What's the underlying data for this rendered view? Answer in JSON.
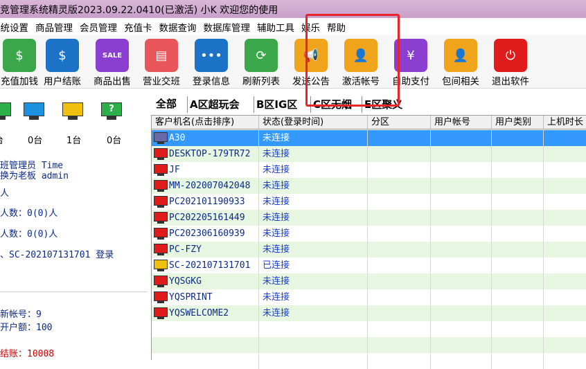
{
  "window": {
    "title": "竞管理系统精灵版2023.09.22.0410(已激活)  小K 欢迎您的使用"
  },
  "menu": [
    "系统设置",
    "商品管理",
    "会员管理",
    "充值卡",
    "数据查询",
    "数据库管理",
    "辅助工具",
    "娱乐",
    "帮助"
  ],
  "toolbar": [
    {
      "label": "充值加钱",
      "icon": "money-bag-icon",
      "color": "#3aa84a",
      "glyph": "$"
    },
    {
      "label": "用户结账",
      "icon": "checkout-icon",
      "color": "#1b72c7",
      "glyph": "$"
    },
    {
      "label": "商品出售",
      "icon": "sale-tag-icon",
      "color": "#8a3fd1",
      "glyph": "SALE"
    },
    {
      "label": "营业交班",
      "icon": "shift-icon",
      "color": "#e8565a",
      "glyph": "▤"
    },
    {
      "label": "登录信息",
      "icon": "chat-icon",
      "color": "#1b72c7",
      "glyph": "•••"
    },
    {
      "label": "刷新列表",
      "icon": "refresh-icon",
      "color": "#3aa84a",
      "glyph": "⟳"
    },
    {
      "label": "发送公告",
      "icon": "megaphone-icon",
      "color": "#f0a41b",
      "glyph": "📢"
    },
    {
      "label": "激活帐号",
      "icon": "user-icon",
      "color": "#f0a41b",
      "glyph": "👤"
    },
    {
      "label": "自助支付",
      "icon": "pay-icon",
      "color": "#8a3fd1",
      "glyph": "¥"
    },
    {
      "label": "包间相关",
      "icon": "room-user-icon",
      "color": "#f0a41b",
      "glyph": "👤"
    },
    {
      "label": "退出软件",
      "icon": "power-icon",
      "color": "#e01b1b",
      "glyph": "⏻"
    }
  ],
  "left": {
    "monitors": [
      {
        "color": "#2db04a",
        "count": "台",
        "label": ""
      },
      {
        "color": "#1e90e0",
        "count": "0台",
        "label": ""
      },
      {
        "color": "#f0c010",
        "count": "1台",
        "label": ""
      },
      {
        "color": "#2db04a",
        "count": "0台",
        "label": "?"
      }
    ],
    "lines": [
      "班管理员 Time",
      "换为老板 admin",
      "人",
      "人数：0(0)人",
      "人数：0(0)人",
      "、SC-202107131701 登录"
    ],
    "lower": [
      "新帐号：9",
      "开户额：100"
    ],
    "checkout": "结账：10008"
  },
  "tabs": [
    "全部",
    "A区超玩会",
    "B区IG区",
    "C区无烟",
    "E区聚义"
  ],
  "columns": [
    "客户机名(点击排序)",
    "状态(登录时间)",
    "分区",
    "用户帐号",
    "用户类别",
    "上机时长"
  ],
  "rows": [
    {
      "name": "A30",
      "status": "未连接",
      "icon": "#6a6aaa",
      "selected": true
    },
    {
      "name": "DESKTOP-179TR72",
      "status": "未连接",
      "icon": "#e01b1b"
    },
    {
      "name": "JF",
      "status": "未连接",
      "icon": "#e01b1b"
    },
    {
      "name": "MM-202007042048",
      "status": "未连接",
      "icon": "#e01b1b"
    },
    {
      "name": "PC202101190933",
      "status": "未连接",
      "icon": "#e01b1b"
    },
    {
      "name": "PC202205161449",
      "status": "未连接",
      "icon": "#e01b1b"
    },
    {
      "name": "PC202306160939",
      "status": "未连接",
      "icon": "#e01b1b"
    },
    {
      "name": "PC-FZY",
      "status": "未连接",
      "icon": "#e01b1b"
    },
    {
      "name": "SC-202107131701",
      "status": "已连接",
      "icon": "#f0c010"
    },
    {
      "name": "YQSGKG",
      "status": "未连接",
      "icon": "#e01b1b"
    },
    {
      "name": "YQSPRINT",
      "status": "未连接",
      "icon": "#e01b1b"
    },
    {
      "name": "YQSWELCOME2",
      "status": "未连接",
      "icon": "#e01b1b"
    },
    {
      "name": "",
      "status": "",
      "icon": ""
    },
    {
      "name": "",
      "status": "",
      "icon": ""
    },
    {
      "name": "",
      "status": "",
      "icon": ""
    }
  ]
}
